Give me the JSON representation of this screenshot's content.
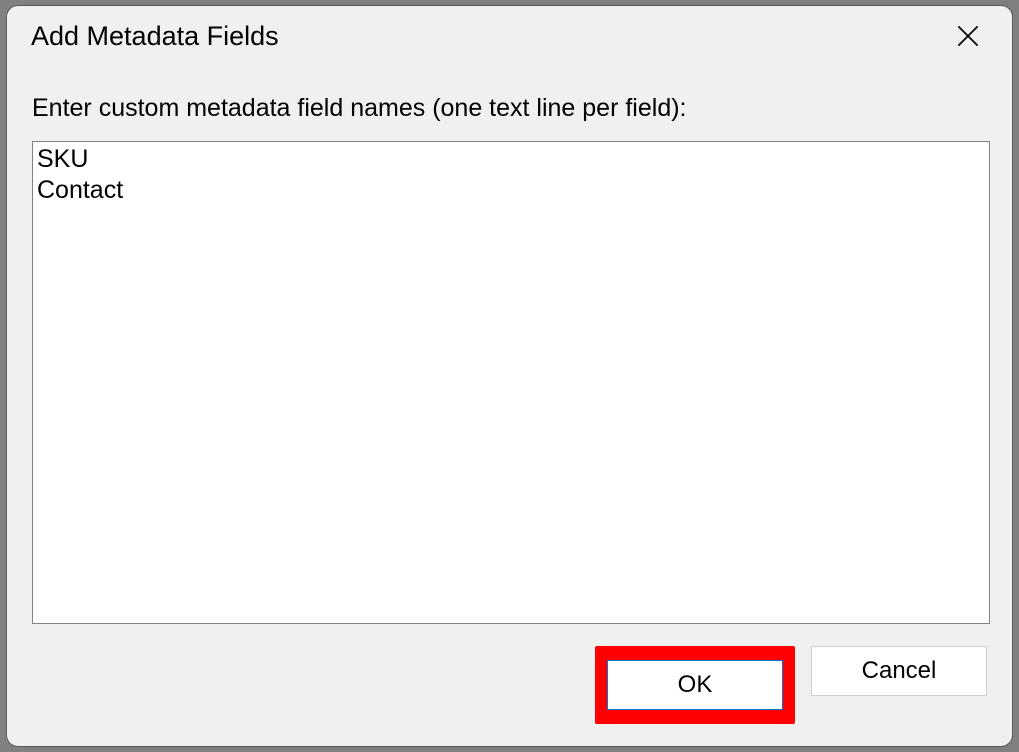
{
  "dialog": {
    "title": "Add Metadata Fields",
    "prompt": "Enter custom metadata field names (one text line per field):",
    "textarea_value": "SKU\nContact",
    "ok_label": "OK",
    "cancel_label": "Cancel"
  }
}
